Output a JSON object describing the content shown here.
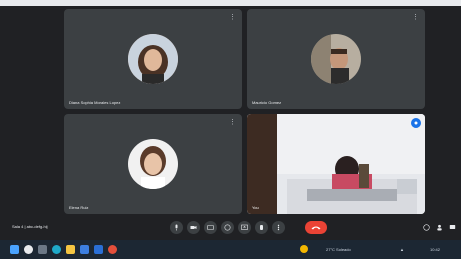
{
  "participants": [
    {
      "name": "Diana Sophia Morales Lopez",
      "badge": "dots-icon"
    },
    {
      "name": "Mauricio Gomez",
      "badge": "dots-icon"
    },
    {
      "name": "Elena Ruiz",
      "badge": "dots-icon"
    },
    {
      "name": "You",
      "badge": "pin-icon"
    }
  ],
  "controls": {
    "meeting_label": "Sala 4 | abc-defg-hij",
    "buttons": [
      "mic-icon",
      "camera-icon",
      "captions-icon",
      "emoji-icon",
      "present-icon",
      "raise-hand-icon",
      "more-icon"
    ],
    "end_call": "end-call-icon"
  },
  "taskbar": {
    "tray_text": "27°C  Soleado",
    "clock": "10:42"
  },
  "colors": {
    "accent": "#1a73e8",
    "end_call": "#ea4335",
    "tile_bg": "#3c4043",
    "stage_bg": "#202124"
  }
}
